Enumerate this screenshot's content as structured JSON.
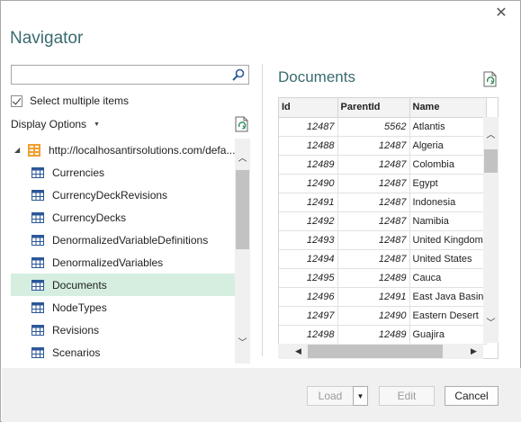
{
  "window": {
    "title": "Navigator"
  },
  "search": {
    "placeholder": "",
    "value": ""
  },
  "select_multiple": {
    "label": "Select multiple items",
    "checked": true
  },
  "display_options": {
    "label": "Display Options"
  },
  "tree": {
    "root": {
      "label": "http://localhosantirsolutions.com/defa..."
    },
    "items": [
      {
        "label": "Currencies",
        "selected": false
      },
      {
        "label": "CurrencyDeckRevisions",
        "selected": false
      },
      {
        "label": "CurrencyDecks",
        "selected": false
      },
      {
        "label": "DenormalizedVariableDefinitions",
        "selected": false
      },
      {
        "label": "DenormalizedVariables",
        "selected": false
      },
      {
        "label": "Documents",
        "selected": true
      },
      {
        "label": "NodeTypes",
        "selected": false
      },
      {
        "label": "Revisions",
        "selected": false
      },
      {
        "label": "Scenarios",
        "selected": false
      }
    ]
  },
  "preview": {
    "title": "Documents",
    "columns": [
      "Id",
      "ParentId",
      "Name"
    ],
    "rows": [
      [
        "12487",
        "5562",
        "Atlantis"
      ],
      [
        "12488",
        "12487",
        "Algeria"
      ],
      [
        "12489",
        "12487",
        "Colombia"
      ],
      [
        "12490",
        "12487",
        "Egypt"
      ],
      [
        "12491",
        "12487",
        "Indonesia"
      ],
      [
        "12492",
        "12487",
        "Namibia"
      ],
      [
        "12493",
        "12487",
        "United Kingdom"
      ],
      [
        "12494",
        "12487",
        "United States"
      ],
      [
        "12495",
        "12489",
        "Cauca"
      ],
      [
        "12496",
        "12491",
        "East Java Basin"
      ],
      [
        "12497",
        "12490",
        "Eastern Desert"
      ],
      [
        "12498",
        "12489",
        "Guajira"
      ]
    ]
  },
  "footer": {
    "load_label": "Load",
    "edit_label": "Edit",
    "cancel_label": "Cancel"
  },
  "colors": {
    "accent": "#3a6b6f",
    "selected_row": "#d5eee0",
    "db_icon": "#f0a030"
  },
  "icons": {
    "close": "close-icon",
    "search": "search-icon",
    "refresh": "refresh-icon",
    "database": "database-icon",
    "table": "table-icon"
  }
}
